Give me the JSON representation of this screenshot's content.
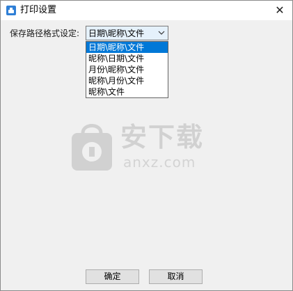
{
  "window": {
    "title": "打印设置",
    "close_symbol": "✕"
  },
  "form": {
    "path_format_label": "保存路径格式设定:",
    "path_format_value": "日期\\昵称\\文件",
    "options": [
      "日期\\昵称\\文件",
      "昵称\\日期\\文件",
      "月份\\昵称\\文件",
      "昵称\\月份\\文件",
      "昵称\\文件"
    ],
    "selected_index": 0
  },
  "watermark": {
    "text_cn": "安下载",
    "text_en": "anxz.com"
  },
  "buttons": {
    "ok_label": "确定",
    "cancel_label": "取消"
  },
  "icons": {
    "app": "printer-settings-icon",
    "close": "close-icon",
    "dropdown": "chevron-down-icon"
  },
  "colors": {
    "selection": "#0078d7",
    "combo_bg": "#e5f1fb",
    "window_bg": "#f0f0f0"
  }
}
